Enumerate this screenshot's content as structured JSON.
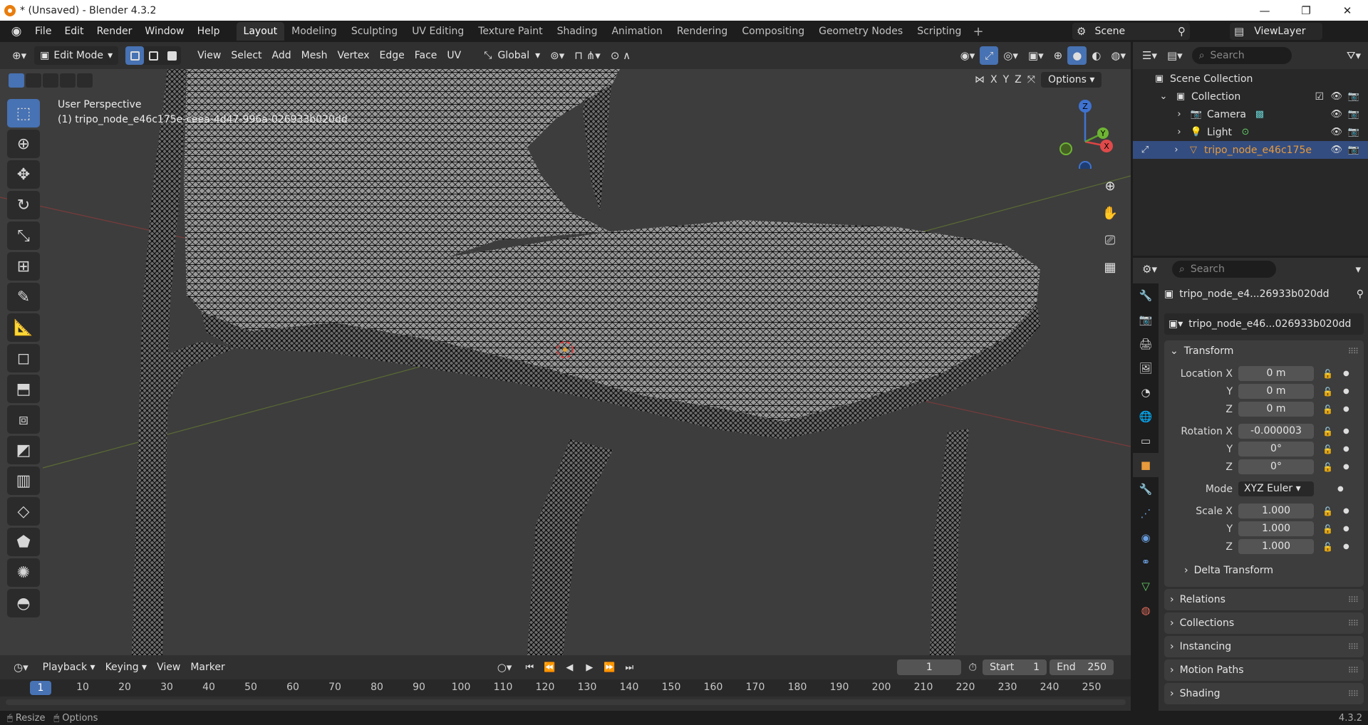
{
  "window": {
    "title": "* (Unsaved) - Blender 4.3.2",
    "min_label": "—",
    "max_label": "❐",
    "close_label": "✕"
  },
  "menu": [
    "File",
    "Edit",
    "Render",
    "Window",
    "Help"
  ],
  "workspaces": [
    "Layout",
    "Modeling",
    "Sculpting",
    "UV Editing",
    "Texture Paint",
    "Shading",
    "Animation",
    "Rendering",
    "Compositing",
    "Geometry Nodes",
    "Scripting"
  ],
  "active_workspace": "Layout",
  "scene": {
    "name": "Scene",
    "view_layer": "ViewLayer"
  },
  "viewport_header": {
    "mode": "Edit Mode",
    "menus": [
      "View",
      "Select",
      "Add",
      "Mesh",
      "Vertex",
      "Edge",
      "Face",
      "UV"
    ],
    "orientation": "Global",
    "axes": [
      "X",
      "Y",
      "Z"
    ],
    "options": "Options"
  },
  "viewport": {
    "perspective": "User Perspective",
    "object_label": "(1) tripo_node_e46c175e-ceea-4d47-996a-026933b020dd",
    "gizmo": {
      "z": "Z",
      "y": "Y",
      "x": "X"
    }
  },
  "outliner": {
    "search_placeholder": "Search",
    "root": "Scene Collection",
    "collection": "Collection",
    "items": [
      {
        "name": "Camera"
      },
      {
        "name": "Light"
      },
      {
        "name": "tripo_node_e46c175e"
      }
    ]
  },
  "properties": {
    "search_placeholder": "Search",
    "object_name": "tripo_node_e4...26933b020dd",
    "data_name": "tripo_node_e46...026933b020dd",
    "transform_label": "Transform",
    "location": {
      "label": "Location X",
      "x": "0 m",
      "y": "0 m",
      "z": "0 m"
    },
    "rotation": {
      "label": "Rotation X",
      "x": "-0.000003",
      "y": "0°",
      "z": "0°"
    },
    "mode_label": "Mode",
    "mode_value": "XYZ Euler",
    "scale": {
      "label": "Scale X",
      "x": "1.000",
      "y": "1.000",
      "z": "1.000"
    },
    "axis_y": "Y",
    "axis_z": "Z",
    "sections": [
      "Delta Transform",
      "Relations",
      "Collections",
      "Instancing",
      "Motion Paths",
      "Shading"
    ]
  },
  "timeline": {
    "menus": [
      "Playback",
      "Keying",
      "View",
      "Marker"
    ],
    "current_frame": "1",
    "start_label": "Start",
    "start": "1",
    "end_label": "End",
    "end": "250",
    "ruler": [
      "1",
      "10",
      "20",
      "30",
      "40",
      "50",
      "60",
      "70",
      "80",
      "90",
      "100",
      "110",
      "120",
      "130",
      "140",
      "150",
      "160",
      "170",
      "180",
      "190",
      "200",
      "210",
      "220",
      "230",
      "240",
      "250"
    ]
  },
  "statusbar": {
    "left1": "Resize",
    "left2": "Options",
    "version": "4.3.2"
  },
  "colors": {
    "accent": "#4772b3",
    "selection_row": "#334d80",
    "object_orange": "#e89a3c"
  }
}
